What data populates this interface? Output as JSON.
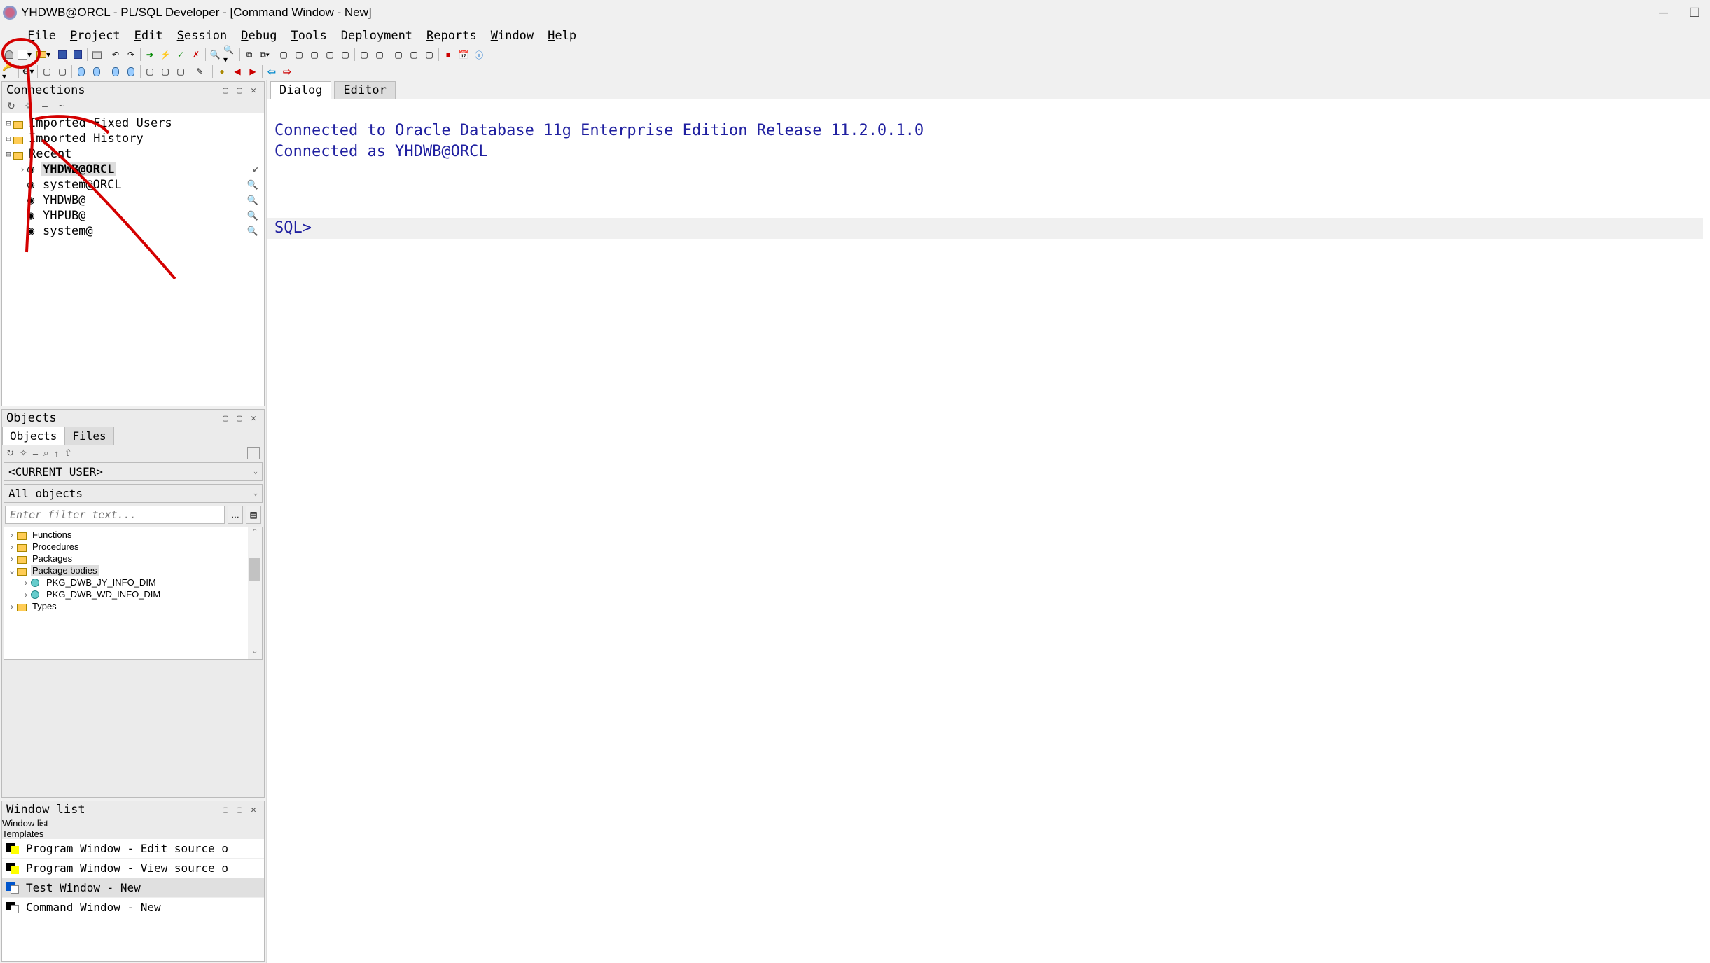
{
  "window": {
    "title": "YHDWB@ORCL - PL/SQL Developer - [Command Window - New]"
  },
  "menus": {
    "file": "File",
    "edit": "Edit",
    "project": "Project",
    "session": "Session",
    "debug": "Debug",
    "tools": "Tools",
    "deployment": "Deployment",
    "reports": "Reports",
    "window": "Window",
    "help": "Help"
  },
  "panels": {
    "connections": {
      "title": "Connections",
      "tree": {
        "imported_fixed": "Imported Fixed Users",
        "imported_hist": "Imported History",
        "recent": "Recent",
        "items": [
          "YHDWB@ORCL",
          "system@ORCL",
          "YHDWB@",
          "YHPUB@",
          "system@"
        ]
      }
    },
    "objects": {
      "title": "Objects",
      "tabs": {
        "objects": "Objects",
        "files": "Files"
      },
      "current_user": "<CURRENT USER>",
      "all_objects": "All objects",
      "filter_placeholder": "Enter filter text...",
      "tree": {
        "functions": "Functions",
        "procedures": "Procedures",
        "packages": "Packages",
        "package_bodies": "Package bodies",
        "pkg1": "PKG_DWB_JY_INFO_DIM",
        "pkg2": "PKG_DWB_WD_INFO_DIM",
        "types": "Types"
      }
    },
    "windowlist": {
      "title": "Window list",
      "tabs": {
        "list": "Window list",
        "templates": "Templates"
      },
      "items": {
        "prog_edit": "Program Window - Edit source o",
        "prog_view": "Program Window - View source o",
        "test_new": "Test Window - New",
        "cmd_new": "Command Window - New"
      }
    }
  },
  "main": {
    "tabs": {
      "dialog": "Dialog",
      "editor": "Editor"
    },
    "lines": {
      "l1": "Connected to Oracle Database 11g Enterprise Edition Release 11.2.0.1.0 ",
      "l2": "Connected as YHDWB@ORCL",
      "prompt": "SQL> "
    }
  }
}
